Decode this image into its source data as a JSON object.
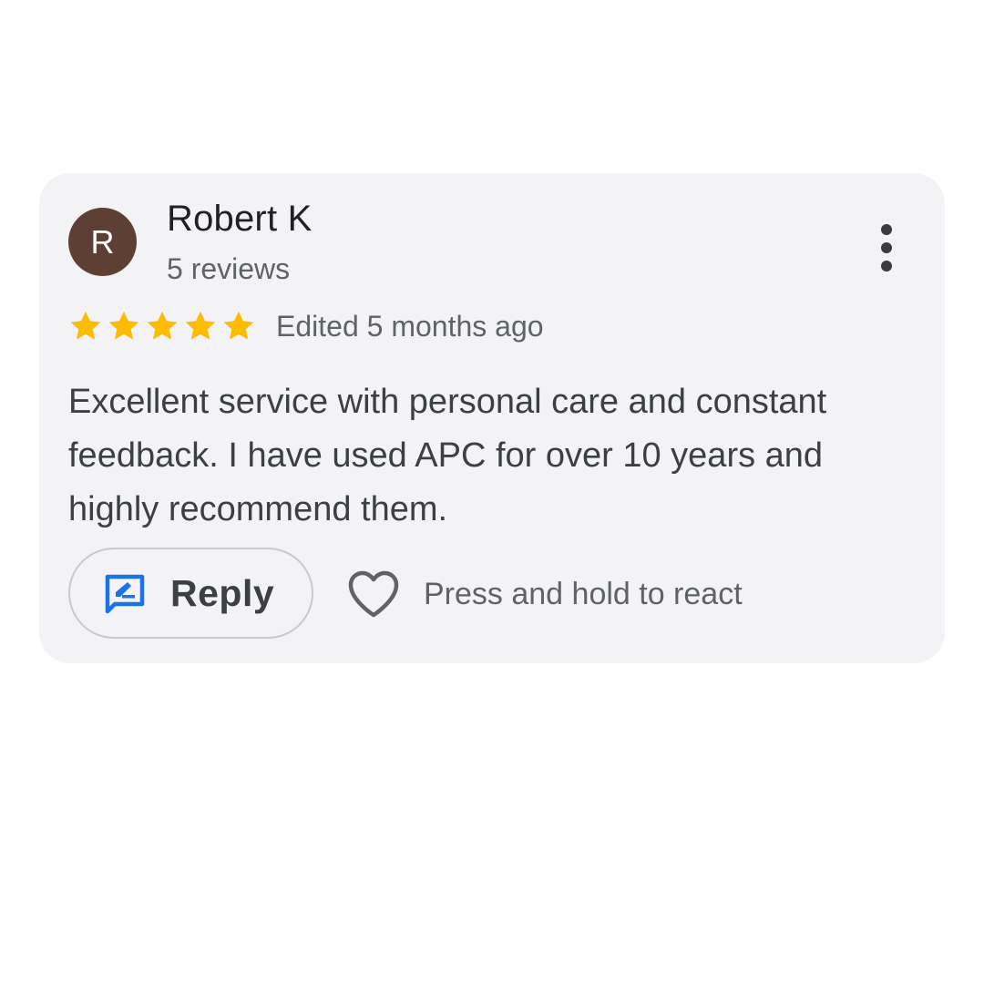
{
  "review": {
    "avatar_initial": "R",
    "author_name": "Robert K",
    "author_reviews": "5 reviews",
    "rating": 5,
    "rating_max": 5,
    "edited_label": "Edited 5 months ago",
    "text": "Excellent service with personal care and constant feedback. I have used APC for over 10 years and highly recommend them.",
    "more_options_icon": "more-vertical-icon"
  },
  "actions": {
    "reply_label": "Reply",
    "reply_icon": "reply-edit-icon",
    "react_label": "Press and hold to react",
    "react_icon": "heart-outline-icon"
  },
  "colors": {
    "avatar_bg": "#5d4033",
    "star": "#fbbc04",
    "reply_icon": "#1a73e8",
    "card_bg": "#f3f3f5"
  }
}
